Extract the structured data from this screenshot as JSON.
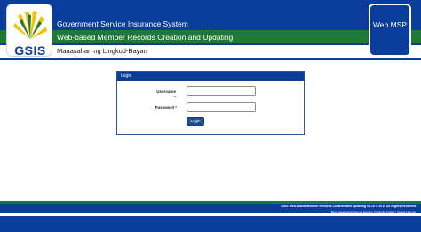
{
  "header": {
    "logo_text": "GSIS",
    "title": "Government Service Insurance System",
    "subtitle": "Web-based Member Records Creation and Updating",
    "motto": "Maaasahan ng Lingkod-Bayan",
    "badge": "Web MSP"
  },
  "login": {
    "panel_title": "Login",
    "username_label": "Username",
    "password_label": "Password",
    "required_mark": "*",
    "username_value": "",
    "password_value": "",
    "submit_label": "Login"
  },
  "footer": {
    "copyright": "GSIS Web-based Member Records Creation and Updating v3.10 © 2015 All Rights Reserved",
    "browser_note": "Best viewed using Internet Explorer 9 | Mozilla Firefox | Google Chrome"
  },
  "colors": {
    "brand_blue": "#0a3d99",
    "brand_green": "#1e7a2e",
    "sun_yellow": "#f2c200"
  }
}
